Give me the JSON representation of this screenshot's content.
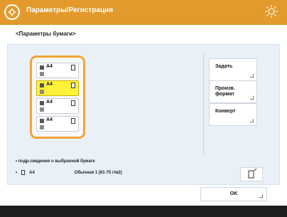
{
  "header": {
    "title": "Параметры/Регистрация",
    "icon": "settings-registration-icon",
    "accent_color": "#e29a2c"
  },
  "page": {
    "subtitle": "<Параметры бумаги>"
  },
  "trays": [
    {
      "label": "A4",
      "selected": false
    },
    {
      "label": "A4",
      "selected": true
    },
    {
      "label": "A4",
      "selected": false
    },
    {
      "label": "A4",
      "selected": false
    }
  ],
  "side_buttons": {
    "set": "Задать",
    "free_format": "Произв. формат",
    "envelope": "Конверт"
  },
  "info": {
    "line1": "• подр.сведения о выбранной бумаге",
    "bullet": "•",
    "tray_code": "A4",
    "paper_type": "Обычная 1 (61-75 г/м2)"
  },
  "footer": {
    "ok_label": "OK"
  }
}
